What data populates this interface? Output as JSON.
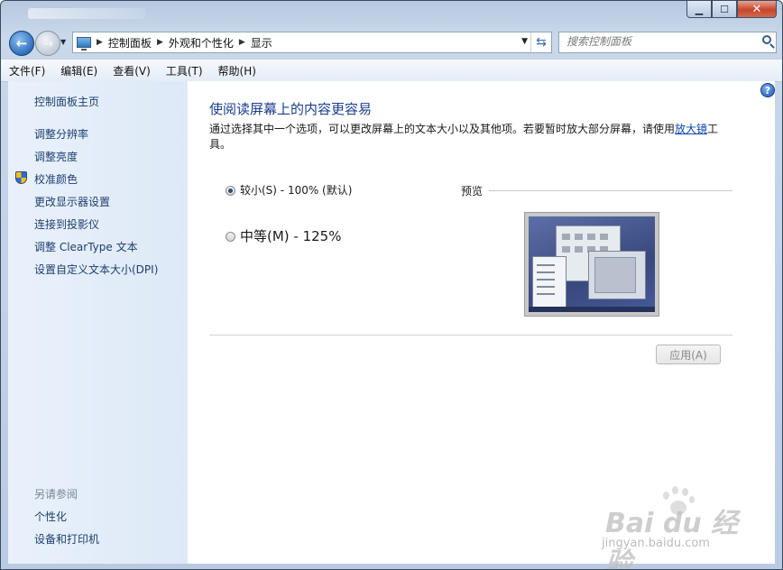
{
  "window": {
    "caption_buttons": {
      "minimize": "▁",
      "maximize": "☐",
      "close": "✕"
    }
  },
  "address_bar": {
    "breadcrumbs": [
      "控制面板",
      "外观和个性化",
      "显示"
    ],
    "search_placeholder": "搜索控制面板"
  },
  "menu": [
    "文件(F)",
    "编辑(E)",
    "查看(V)",
    "工具(T)",
    "帮助(H)"
  ],
  "sidebar": {
    "home": "控制面板主页",
    "links": [
      "调整分辨率",
      "调整亮度",
      "校准颜色",
      "更改显示器设置",
      "连接到投影仪",
      "调整 ClearType 文本",
      "设置自定义文本大小(DPI)"
    ],
    "see_also_heading": "另请参阅",
    "see_also": [
      "个性化",
      "设备和打印机"
    ]
  },
  "main": {
    "title": "使阅读屏幕上的内容更容易",
    "description_before_link": "通过选择其中一个选项，可以更改屏幕上的文本大小以及其他项。若要暂时放大部分屏幕，请使用",
    "description_link": "放大镜",
    "description_after_link": "工具。",
    "options": [
      {
        "label": "较小(S) - 100% (默认)",
        "selected": true
      },
      {
        "label": "中等(M) - 125%",
        "selected": false
      }
    ],
    "preview_label": "预览",
    "apply_button": "应用(A)"
  },
  "watermark": {
    "logo": "Bai du 经验",
    "url": "jingyan.baidu.com"
  },
  "icons": {
    "back": "back-arrow-icon",
    "forward": "forward-arrow-icon",
    "refresh": "refresh-icon",
    "search": "search-icon",
    "help": "help-icon",
    "shield": "uac-shield-icon",
    "computer": "computer-icon"
  }
}
